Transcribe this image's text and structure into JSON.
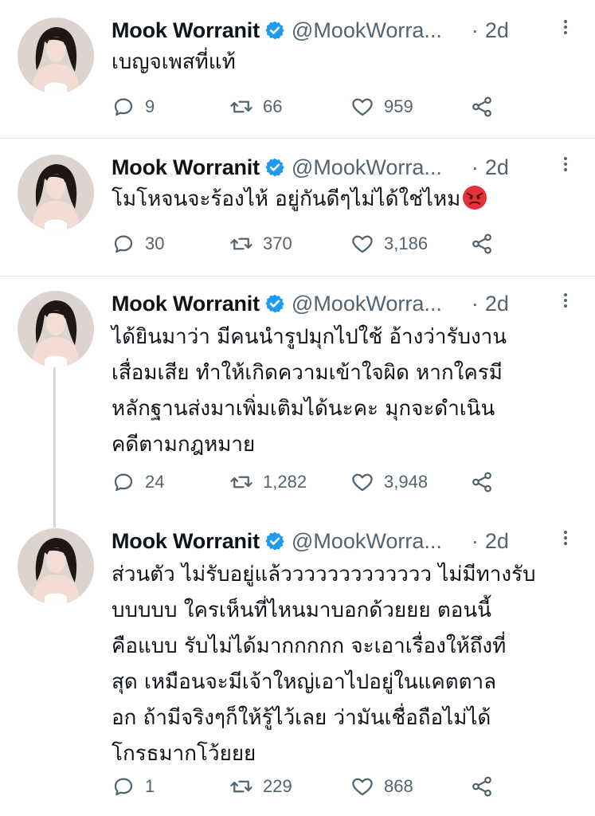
{
  "colors": {
    "text_primary": "#0f1419",
    "text_secondary": "#536471",
    "verified_blue": "#1d9bf0",
    "divider": "#e3e6e8",
    "thread_line": "#cfd9de"
  },
  "icons": {
    "verified": "verified-badge-icon",
    "reply": "reply-icon",
    "retweet": "retweet-icon",
    "like": "heart-icon",
    "share": "share-icon",
    "more": "more-vertical-icon"
  },
  "tweets": [
    {
      "author": {
        "name": "Mook Worranit",
        "handle": "@MookWorra...",
        "separator": "·",
        "time": "2d"
      },
      "text_lines": [
        "เบญจเพสที่แท้"
      ],
      "emoji": "",
      "stats": {
        "replies": "9",
        "retweets": "66",
        "likes": "959"
      }
    },
    {
      "author": {
        "name": "Mook Worranit",
        "handle": "@MookWorra...",
        "separator": "·",
        "time": "2d"
      },
      "text_lines": [
        "โมโหจนจะร้องไห้ อยู่กันดีๆไม่ได้ใช่ไหม"
      ],
      "emoji": "😡",
      "stats": {
        "replies": "30",
        "retweets": "370",
        "likes": "3,186"
      }
    },
    {
      "author": {
        "name": "Mook Worranit",
        "handle": "@MookWorra...",
        "separator": "·",
        "time": "2d"
      },
      "text_lines": [
        "ได้ยินมาว่า มีคนนำรูปมุกไปใช้ อ้างว่ารับงาน",
        "เสื่อมเสีย ทำให้เกิดความเข้าใจผิด หากใครมี",
        "หลักฐานส่งมาเพิ่มเติมได้นะคะ มุกจะดำเนิน",
        "คดีตามกฎหมาย"
      ],
      "emoji": "",
      "stats": {
        "replies": "24",
        "retweets": "1,282",
        "likes": "3,948"
      }
    },
    {
      "author": {
        "name": "Mook Worranit",
        "handle": "@MookWorra...",
        "separator": "·",
        "time": "2d"
      },
      "text_lines": [
        "ส่วนตัว ไม่รับอยู่แล้ววววววววววววว ไม่มีทางรับ",
        "บบบบบ ใครเห็นที่ไหนมาบอกด้วยยย ตอนนี้",
        "คือแบบ รับไม่ได้มากกกกก จะเอาเรื่องให้ถึงที่",
        "สุด เหมือนจะมีเจ้าใหญ่เอาไปอยู่ในแคตตาล",
        "อก ถ้ามีจริงๆก็ให้รู้ไว้เลย ว่ามันเชื่อถือไม่ได้",
        "โกรธมากโว้ยยย"
      ],
      "emoji": "",
      "stats": {
        "replies": "1",
        "retweets": "229",
        "likes": "868"
      }
    }
  ]
}
